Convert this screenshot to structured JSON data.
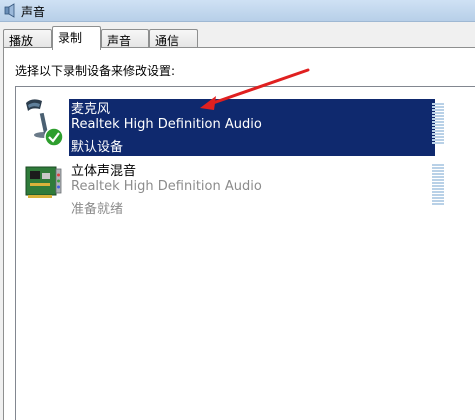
{
  "window": {
    "title": "声音"
  },
  "tabs": [
    {
      "label": "播放",
      "active": false
    },
    {
      "label": "录制",
      "active": true
    },
    {
      "label": "声音",
      "active": false
    },
    {
      "label": "通信",
      "active": false
    }
  ],
  "instruction": "选择以下录制设备来修改设置:",
  "devices": [
    {
      "name": "麦克风",
      "driver": "Realtek High Definition Audio",
      "status": "默认设备",
      "icon": "microphone-icon",
      "badge": "default-checkmark-icon",
      "selected": true
    },
    {
      "name": "立体声混音",
      "driver": "Realtek High Definition Audio",
      "status": "准备就绪",
      "icon": "sound-card-icon",
      "selected": false
    }
  ],
  "colors": {
    "selection": "#0f296e",
    "annotation_arrow": "#e02020",
    "level_meter": "#b9d1e7",
    "disabled_text": "#8c8c8c"
  }
}
